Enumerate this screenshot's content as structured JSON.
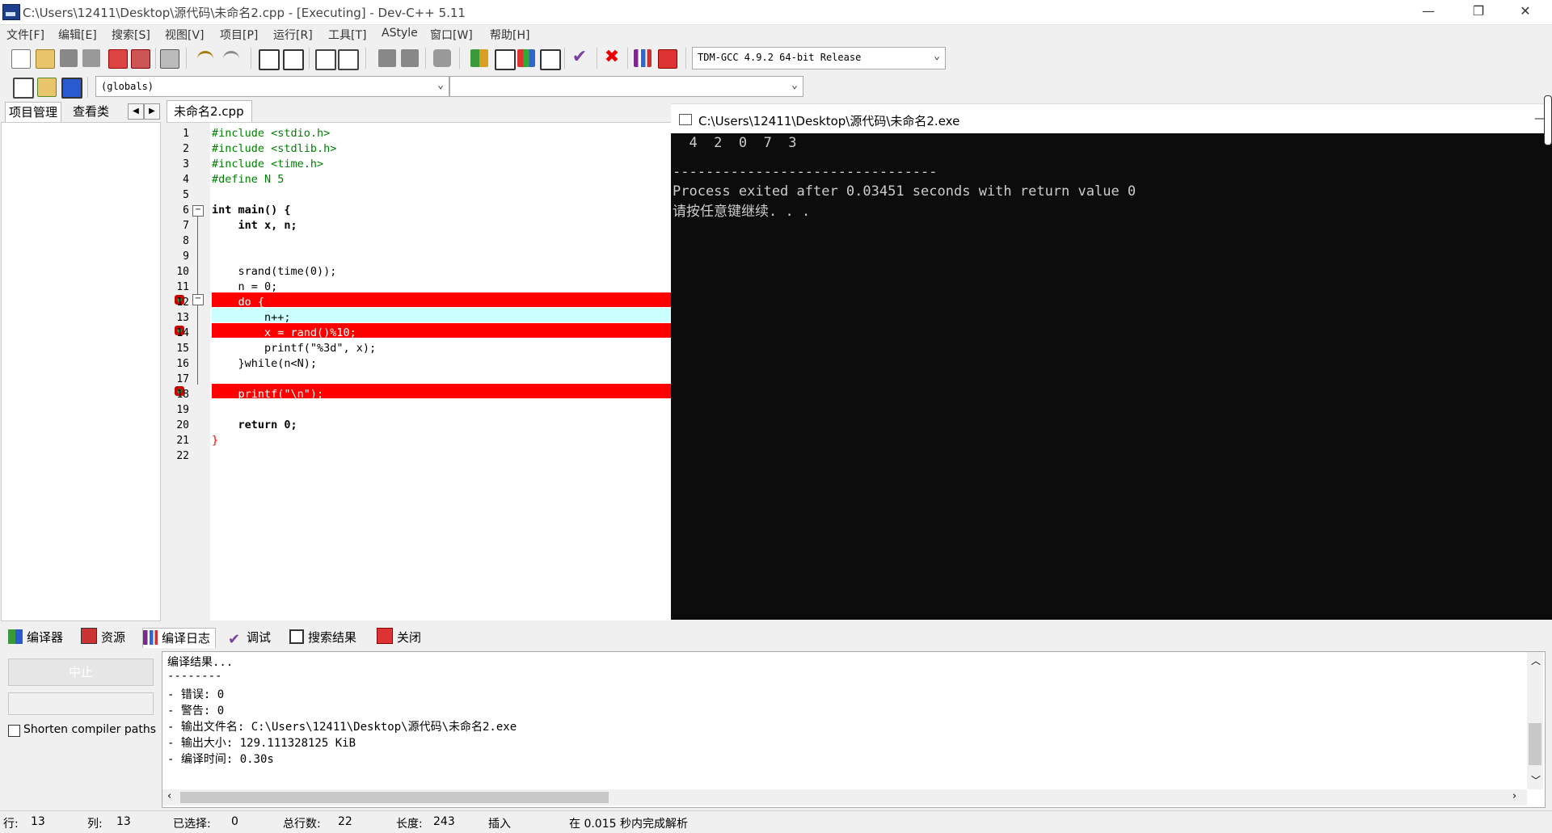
{
  "window": {
    "title": "C:\\Users\\12411\\Desktop\\源代码\\未命名2.cpp - [Executing] - Dev-C++ 5.11",
    "minimize": "—",
    "restore": "❐",
    "close": "✕"
  },
  "menu": [
    "文件[F]",
    "编辑[E]",
    "搜索[S]",
    "视图[V]",
    "项目[P]",
    "运行[R]",
    "工具[T]",
    "AStyle",
    "窗口[W]",
    "帮助[H]"
  ],
  "toolbar": {
    "compiler": "TDM-GCC 4.9.2 64-bit Release",
    "scope": "(globals)",
    "member": ""
  },
  "left_tabs": [
    "项目管理",
    "查看类"
  ],
  "editor": {
    "tab": "未命名2.cpp",
    "lines": [
      {
        "n": "1",
        "code": "#include <stdio.h>"
      },
      {
        "n": "2",
        "code": "#include <stdlib.h>"
      },
      {
        "n": "3",
        "code": "#include <time.h>"
      },
      {
        "n": "4",
        "code": "#define N 5"
      },
      {
        "n": "5",
        "code": ""
      },
      {
        "n": "6",
        "code": "int main() {"
      },
      {
        "n": "7",
        "code": "    int x, n;"
      },
      {
        "n": "8",
        "code": ""
      },
      {
        "n": "9",
        "code": ""
      },
      {
        "n": "10",
        "code": "    srand(time(0));"
      },
      {
        "n": "11",
        "code": "    n = 0;"
      },
      {
        "n": "12",
        "code": "    do {"
      },
      {
        "n": "13",
        "code": "        n++;"
      },
      {
        "n": "14",
        "code": "        x = rand()%10;"
      },
      {
        "n": "15",
        "code": "        printf(\"%3d\", x);"
      },
      {
        "n": "16",
        "code": "    }while(n<N);"
      },
      {
        "n": "17",
        "code": ""
      },
      {
        "n": "18",
        "code": "    printf(\"\\n\");"
      },
      {
        "n": "19",
        "code": ""
      },
      {
        "n": "20",
        "code": "    return 0;"
      },
      {
        "n": "21",
        "code": "}"
      },
      {
        "n": "22",
        "code": ""
      }
    ]
  },
  "console": {
    "title": "C:\\Users\\12411\\Desktop\\源代码\\未命名2.exe",
    "lines": [
      "  4  2  0  7  3",
      "",
      "--------------------------------",
      "Process exited after 0.03451 seconds with return value 0",
      "请按任意键继续. . ."
    ]
  },
  "bottom_tabs": [
    "编译器",
    "资源",
    "编译日志",
    "调试",
    "搜索结果",
    "关闭"
  ],
  "log": {
    "stop_button": "中止",
    "shorten_label": "Shorten compiler paths",
    "lines": [
      "编译结果...",
      "--------",
      "- 错误: 0",
      "- 警告: 0",
      "- 输出文件名: C:\\Users\\12411\\Desktop\\源代码\\未命名2.exe",
      "- 输出大小: 129.111328125 KiB",
      "- 编译时间: 0.30s"
    ]
  },
  "status": {
    "row_label": "行:",
    "row": "13",
    "col_label": "列:",
    "col": "13",
    "sel_label": "已选择:",
    "sel": "0",
    "lines_label": "总行数:",
    "lines": "22",
    "len_label": "长度:",
    "len": "243",
    "mode": "插入",
    "parse": "在 0.015 秒内完成解析"
  }
}
